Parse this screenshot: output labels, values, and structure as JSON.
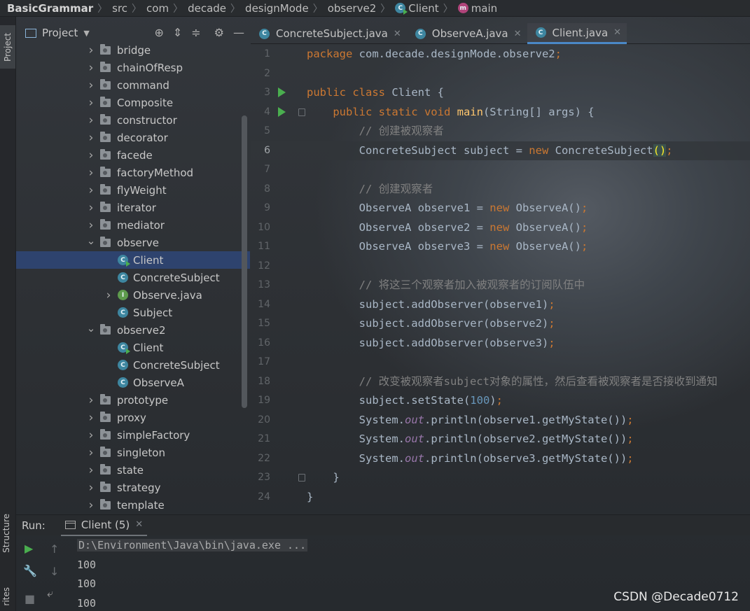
{
  "breadcrumb": {
    "project": "BasicGrammar",
    "segments": [
      "src",
      "com",
      "decade",
      "designMode",
      "observe2"
    ],
    "class_name": "Client",
    "method_badge": "m",
    "method_name": "main"
  },
  "left_strip": {
    "project_tab": "Project",
    "structure_tab": "Structure",
    "favorites_tab": "rites"
  },
  "project_panel": {
    "title": "Project",
    "tree": [
      {
        "label": "bridge",
        "kind": "folder",
        "expanded": false
      },
      {
        "label": "chainOfResp",
        "kind": "folder",
        "expanded": false
      },
      {
        "label": "command",
        "kind": "folder",
        "expanded": false
      },
      {
        "label": "Composite",
        "kind": "folder",
        "expanded": false
      },
      {
        "label": "constructor",
        "kind": "folder",
        "expanded": false
      },
      {
        "label": "decorator",
        "kind": "folder",
        "expanded": false
      },
      {
        "label": "facede",
        "kind": "folder",
        "expanded": false
      },
      {
        "label": "factoryMethod",
        "kind": "folder",
        "expanded": false
      },
      {
        "label": "flyWeight",
        "kind": "folder",
        "expanded": false
      },
      {
        "label": "iterator",
        "kind": "folder",
        "expanded": false
      },
      {
        "label": "mediator",
        "kind": "folder",
        "expanded": false
      },
      {
        "label": "observe",
        "kind": "folder",
        "expanded": true
      },
      {
        "label": "Client",
        "kind": "class-run",
        "selected": true
      },
      {
        "label": "ConcreteSubject",
        "kind": "class"
      },
      {
        "label": "Observe.java",
        "kind": "interface",
        "expanded": false
      },
      {
        "label": "Subject",
        "kind": "class"
      },
      {
        "label": "observe2",
        "kind": "folder",
        "expanded": true
      },
      {
        "label": "Client",
        "kind": "class-run"
      },
      {
        "label": "ConcreteSubject",
        "kind": "class"
      },
      {
        "label": "ObserveA",
        "kind": "class"
      },
      {
        "label": "prototype",
        "kind": "folder",
        "expanded": false
      },
      {
        "label": "proxy",
        "kind": "folder",
        "expanded": false
      },
      {
        "label": "simpleFactory",
        "kind": "folder",
        "expanded": false
      },
      {
        "label": "singleton",
        "kind": "folder",
        "expanded": false
      },
      {
        "label": "state",
        "kind": "folder",
        "expanded": false
      },
      {
        "label": "strategy",
        "kind": "folder",
        "expanded": false
      },
      {
        "label": "template",
        "kind": "folder",
        "expanded": false
      }
    ]
  },
  "editor_tabs": [
    {
      "label": "ConcreteSubject.java",
      "active": false
    },
    {
      "label": "ObserveA.java",
      "active": false
    },
    {
      "label": "Client.java",
      "active": true
    }
  ],
  "editor": {
    "current_line": 6,
    "lines": [
      [
        [
          "kw",
          "package "
        ],
        [
          "pl",
          "com.decade.designMode.observe2"
        ],
        [
          "kw",
          ";"
        ]
      ],
      [],
      [
        [
          "kw",
          "public class "
        ],
        [
          "pl",
          "Client {"
        ]
      ],
      [
        [
          "pl",
          "    "
        ],
        [
          "kw",
          "public static void "
        ],
        [
          "fn",
          "main"
        ],
        [
          "pl",
          "(String[] args) {"
        ]
      ],
      [
        [
          "pl",
          "        "
        ],
        [
          "cm",
          "// 创建被观察者"
        ]
      ],
      [
        [
          "pl",
          "        ConcreteSubject subject = "
        ],
        [
          "kw",
          "new "
        ],
        [
          "pl",
          "ConcreteSubject"
        ],
        [
          "pr",
          "()"
        ],
        [
          "kw",
          ";"
        ]
      ],
      [],
      [
        [
          "pl",
          "        "
        ],
        [
          "cm",
          "// 创建观察者"
        ]
      ],
      [
        [
          "pl",
          "        ObserveA observe1 = "
        ],
        [
          "kw",
          "new "
        ],
        [
          "pl",
          "ObserveA()"
        ],
        [
          "kw",
          ";"
        ]
      ],
      [
        [
          "pl",
          "        ObserveA observe2 = "
        ],
        [
          "kw",
          "new "
        ],
        [
          "pl",
          "ObserveA()"
        ],
        [
          "kw",
          ";"
        ]
      ],
      [
        [
          "pl",
          "        ObserveA observe3 = "
        ],
        [
          "kw",
          "new "
        ],
        [
          "pl",
          "ObserveA()"
        ],
        [
          "kw",
          ";"
        ]
      ],
      [],
      [
        [
          "pl",
          "        "
        ],
        [
          "cm",
          "// 将这三个观察者加入被观察者的订阅队伍中"
        ]
      ],
      [
        [
          "pl",
          "        subject.addObserver(observe1)"
        ],
        [
          "kw",
          ";"
        ]
      ],
      [
        [
          "pl",
          "        subject.addObserver(observe2)"
        ],
        [
          "kw",
          ";"
        ]
      ],
      [
        [
          "pl",
          "        subject.addObserver(observe3)"
        ],
        [
          "kw",
          ";"
        ]
      ],
      [],
      [
        [
          "pl",
          "        "
        ],
        [
          "cm",
          "// 改变被观察者subject对象的属性，然后查看被观察者是否接收到通知"
        ]
      ],
      [
        [
          "pl",
          "        subject.setState("
        ],
        [
          "num",
          "100"
        ],
        [
          "pl",
          ")"
        ],
        [
          "kw",
          ";"
        ]
      ],
      [
        [
          "pl",
          "        System."
        ],
        [
          "st",
          "out"
        ],
        [
          "pl",
          ".println(observe1.getMyState())"
        ],
        [
          "kw",
          ";"
        ]
      ],
      [
        [
          "pl",
          "        System."
        ],
        [
          "st",
          "out"
        ],
        [
          "pl",
          ".println(observe2.getMyState())"
        ],
        [
          "kw",
          ";"
        ]
      ],
      [
        [
          "pl",
          "        System."
        ],
        [
          "st",
          "out"
        ],
        [
          "pl",
          ".println(observe3.getMyState())"
        ],
        [
          "kw",
          ";"
        ]
      ],
      [
        [
          "pl",
          "    }"
        ]
      ],
      [
        [
          "pl",
          "}"
        ]
      ]
    ]
  },
  "run_panel": {
    "label": "Run:",
    "tab_label": "Client (5)",
    "command": "D:\\Environment\\Java\\bin\\java.exe ...",
    "output": [
      "100",
      "100",
      "100"
    ]
  },
  "watermark": "CSDN @Decade0712",
  "colors": {
    "accent": "#4a88c7",
    "selection": "#2e436e",
    "keyword": "#cc7832",
    "comment": "#808080",
    "run_green": "#4aae4f"
  }
}
